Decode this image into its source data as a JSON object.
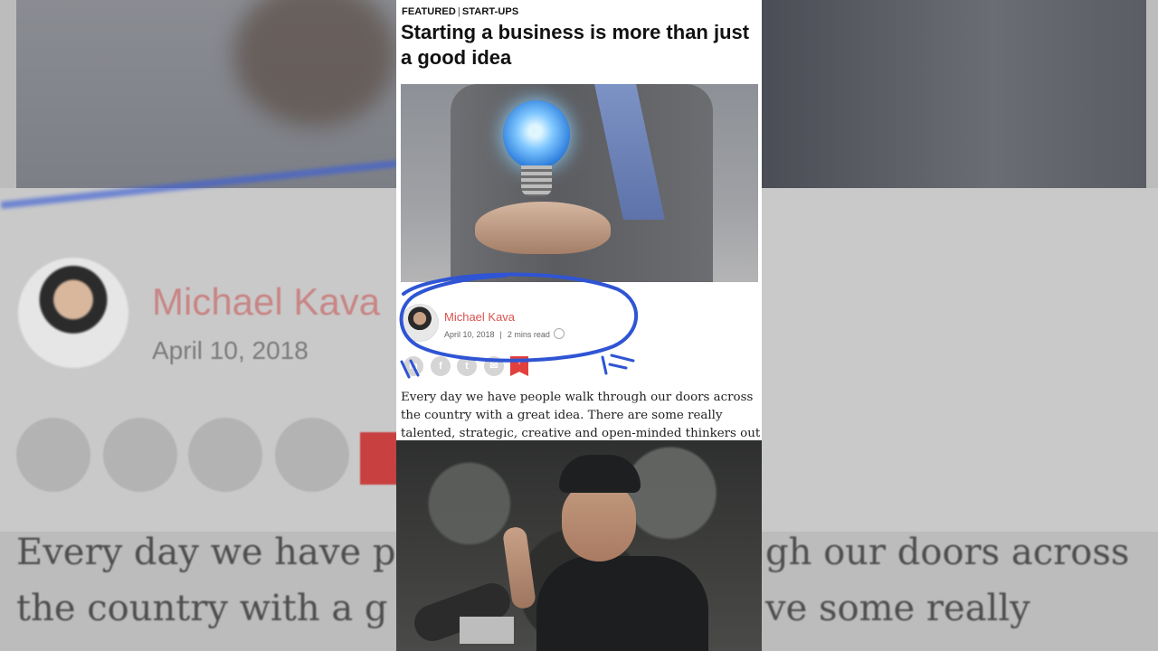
{
  "article": {
    "category": "FEATURED",
    "subcategory": "START-UPS",
    "headline": "Starting a business is more than just a good idea",
    "author_name": "Michael Kava",
    "date": "April 10, 2018",
    "read_time": "2 mins read",
    "body_lines": [
      "Every day we have people walk through our doors across",
      "the country with a great idea. There are some really",
      "talented, strategic, creative and open-minded thinkers out"
    ]
  },
  "social": {
    "linkedin_label": "in",
    "facebook_label": "f",
    "twitter_label": "t",
    "email_label": "✉",
    "bookmark_label": "+"
  },
  "background": {
    "author_name": "Michael Kava",
    "date": "April 10, 2018",
    "text_line_1_left": "Every day we have p",
    "text_line_1_right": "gh our doors across",
    "text_line_2_left": "the country with a g",
    "text_line_2_right": "ve some really"
  },
  "colors": {
    "accent_red": "#d9534f",
    "annotation_blue": "#2f55d4"
  }
}
